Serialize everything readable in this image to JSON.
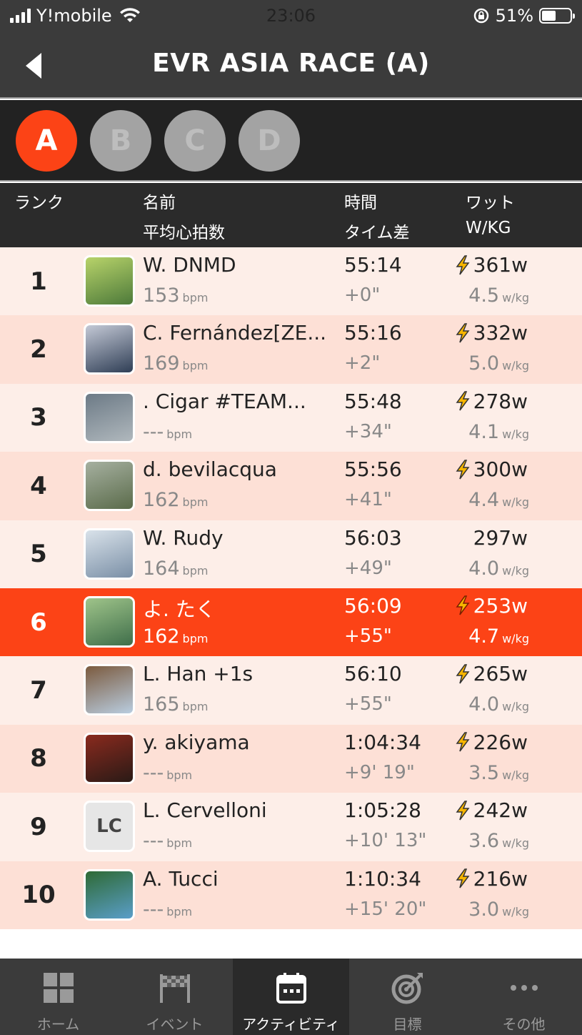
{
  "status_bar": {
    "carrier": "Y!mobile",
    "time": "23:06",
    "battery": "51%",
    "battery_level": 0.51
  },
  "header": {
    "title": "EVR ASIA RACE (A)"
  },
  "categories": [
    "A",
    "B",
    "C",
    "D"
  ],
  "active_category": "A",
  "columns": {
    "rank": "ランク",
    "name": "名前",
    "avg_hr": "平均心拍数",
    "time": "時間",
    "gap": "タイム差",
    "watts": "ワット",
    "wkg": "W/KG"
  },
  "units": {
    "bpm": "bpm",
    "wkg": "w/kg"
  },
  "rows": [
    {
      "rank": "1",
      "name": "W. DNMD",
      "bpm": "153",
      "time": "55:14",
      "gap": "+0\"",
      "watts": "361w",
      "wkg": "4.5",
      "bolt": true
    },
    {
      "rank": "2",
      "name": "C. Fernández[ZE...",
      "bpm": "169",
      "time": "55:16",
      "gap": "+2\"",
      "watts": "332w",
      "wkg": "5.0",
      "bolt": true
    },
    {
      "rank": "3",
      "name": ". Cigar #TEAM...",
      "bpm": "---",
      "time": "55:48",
      "gap": "+34\"",
      "watts": "278w",
      "wkg": "4.1",
      "bolt": true
    },
    {
      "rank": "4",
      "name": "d. bevilacqua",
      "bpm": "162",
      "time": "55:56",
      "gap": "+41\"",
      "watts": "300w",
      "wkg": "4.4",
      "bolt": true
    },
    {
      "rank": "5",
      "name": "W. Rudy",
      "bpm": "164",
      "time": "56:03",
      "gap": "+49\"",
      "watts": "297w",
      "wkg": "4.0",
      "bolt": false
    },
    {
      "rank": "6",
      "name": "よ. たく",
      "bpm": "162",
      "time": "56:09",
      "gap": "+55\"",
      "watts": "253w",
      "wkg": "4.7",
      "bolt": true,
      "me": true
    },
    {
      "rank": "7",
      "name": "L. Han +1s",
      "bpm": "165",
      "time": "56:10",
      "gap": "+55\"",
      "watts": "265w",
      "wkg": "4.0",
      "bolt": true
    },
    {
      "rank": "8",
      "name": "y. akiyama",
      "bpm": "---",
      "time": "1:04:34",
      "gap": "+9' 19\"",
      "watts": "226w",
      "wkg": "3.5",
      "bolt": true
    },
    {
      "rank": "9",
      "name": "L. Cervelloni",
      "bpm": "---",
      "time": "1:05:28",
      "gap": "+10' 13\"",
      "watts": "242w",
      "wkg": "3.6",
      "bolt": true,
      "initials": "LC"
    },
    {
      "rank": "10",
      "name": "A. Tucci",
      "bpm": "---",
      "time": "1:10:34",
      "gap": "+15' 20\"",
      "watts": "216w",
      "wkg": "3.0",
      "bolt": true
    }
  ],
  "nav": [
    {
      "label": "ホーム",
      "icon": "home-grid-icon"
    },
    {
      "label": "イベント",
      "icon": "checkered-flag-icon"
    },
    {
      "label": "アクティビティ",
      "icon": "calendar-icon",
      "active": true
    },
    {
      "label": "目標",
      "icon": "target-icon"
    },
    {
      "label": "その他",
      "icon": "more-dots-icon"
    }
  ],
  "colors": {
    "accent": "#fc4316",
    "row_light": "#fdeee8",
    "row_dark": "#fde0d6",
    "dark_bg": "#2b2b2b"
  }
}
